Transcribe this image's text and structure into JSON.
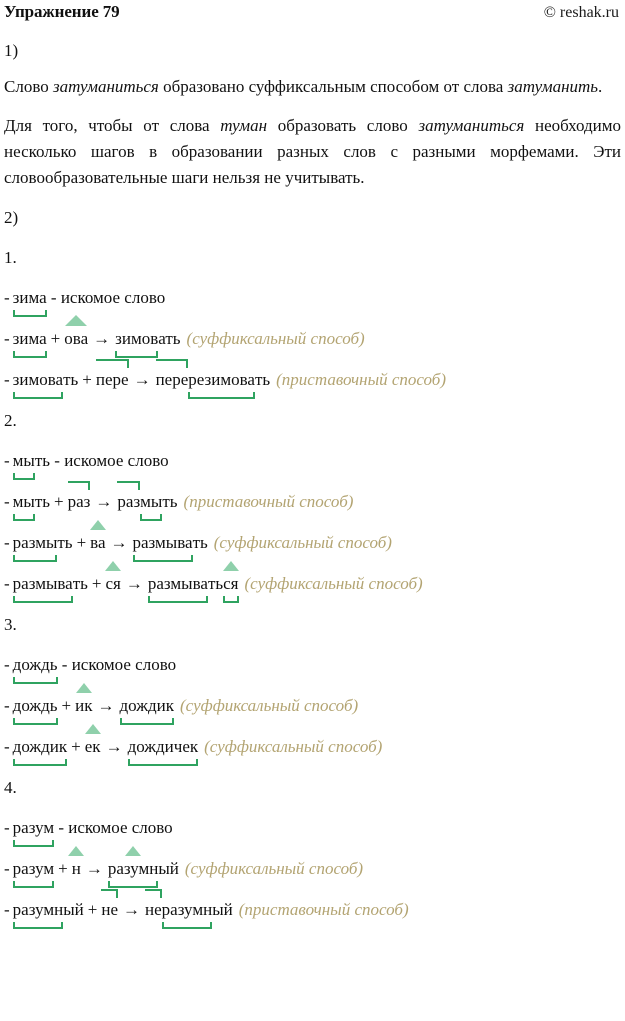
{
  "header": {
    "title": "Упражнение 79",
    "watermark": "© reshak.ru"
  },
  "part1": {
    "marker": "1)",
    "paragraphs": [
      {
        "id": "p1",
        "runs": [
          {
            "text": "Слово ",
            "style": "normal"
          },
          {
            "text": "затуманиться",
            "style": "italic"
          },
          {
            "text": " образовано суффиксальным способом от слова ",
            "style": "normal"
          },
          {
            "text": "затуманить",
            "style": "italic"
          },
          {
            "text": ".",
            "style": "normal"
          }
        ],
        "plain": "Слово затуманиться образовано суффиксальным способом от слова затуманить."
      },
      {
        "id": "p2",
        "runs": [
          {
            "text": "Для того, чтобы от слова ",
            "style": "normal"
          },
          {
            "text": "туман",
            "style": "italic"
          },
          {
            "text": " образовать слово ",
            "style": "normal"
          },
          {
            "text": "затуманиться",
            "style": "italic"
          },
          {
            "text": " необходимо несколько шагов в образовании разных слов с разными морфемами. Эти словообразовательные шаги нельзя не учитывать.",
            "style": "normal"
          }
        ],
        "plain": "Для того, чтобы от слова туман образовать слово затуманиться необходимо несколько шагов в образовании разных слов с разными морфемами. Эти словообразовательные шаги нельзя не учитывать."
      }
    ]
  },
  "part2": {
    "marker": "2)",
    "operators": {
      "dash": "-",
      "plus": "+",
      "arrow": "→"
    },
    "notes": {
      "suffix": "(суффиксальный способ)",
      "prefix": "(приставочный способ)"
    },
    "sought_label": "- искомое слово",
    "sections": [
      {
        "number": "1.",
        "lines": [
          {
            "type": "sought",
            "word": "зима",
            "root": "зима",
            "tail": "",
            "label": "- искомое слово"
          },
          {
            "type": "derive",
            "base_root": "зима",
            "base_tail": "",
            "affix": "ова",
            "affix_kind": "suffix",
            "result_root": "зимов",
            "result_tail": "ать",
            "result_suffix": "ов",
            "note": "(суффиксальный способ)"
          },
          {
            "type": "derive",
            "base_root": "зимова",
            "base_tail": "ть",
            "affix": "пере",
            "affix_kind": "prefix",
            "result_prefix": "пере",
            "result_root": "резимова",
            "result_tail": "ть",
            "note": "(приставочный способ)"
          }
        ]
      },
      {
        "number": "2.",
        "lines": [
          {
            "type": "sought",
            "word": "мыть",
            "root": "мы",
            "tail": "ть",
            "label": "- искомое слово"
          },
          {
            "type": "derive",
            "base_root": "мы",
            "base_tail": "ть",
            "affix": "раз",
            "affix_kind": "prefix",
            "result_prefix": "раз",
            "result_root": "мы",
            "result_tail": "ть",
            "note": "(приставочный способ)"
          },
          {
            "type": "derive",
            "base_root": "размы",
            "base_tail": "ть",
            "affix": "ва",
            "affix_kind": "suffix",
            "result_root": "размыва",
            "result_tail": "ть",
            "result_suffix": "ва",
            "note": "(суффиксальный способ)"
          },
          {
            "type": "derive",
            "base_root": "размыва",
            "base_tail": "ть",
            "affix": "ся",
            "affix_kind": "suffix",
            "result_root": "размыва",
            "result_mid": "ть",
            "result_suffix2": "ся",
            "note": "(суффиксальный способ)"
          }
        ]
      },
      {
        "number": "3.",
        "lines": [
          {
            "type": "sought",
            "word": "дождь",
            "root": "дождь",
            "tail": "",
            "label": "- искомое слово"
          },
          {
            "type": "derive",
            "base_root": "дождь",
            "base_tail": "",
            "affix": "ик",
            "affix_kind": "suffix",
            "result_root": "дождик",
            "result_tail": "",
            "result_suffix": "ик",
            "note": "(суффиксальный способ)"
          },
          {
            "type": "derive",
            "base_root": "дождик",
            "base_tail": "",
            "affix": "ек",
            "affix_kind": "suffix",
            "result_root": "дождичек",
            "result_tail": "",
            "result_suffix": "ек",
            "note": "(суффиксальный способ)"
          }
        ]
      },
      {
        "number": "4.",
        "lines": [
          {
            "type": "sought",
            "word": "разум",
            "root": "разум",
            "tail": "",
            "label": "- искомое слово"
          },
          {
            "type": "derive",
            "base_root": "разум",
            "base_tail": "",
            "affix": "н",
            "affix_kind": "suffix",
            "result_root": "разумн",
            "result_tail": "ый",
            "result_suffix": "н",
            "note": "(суффиксальный способ)"
          },
          {
            "type": "derive",
            "base_root": "разумн",
            "base_tail": "ый",
            "affix": "не",
            "affix_kind": "prefix",
            "result_prefix": "не",
            "result_root": "разумн",
            "result_tail": "ый",
            "note": "(приставочный способ)"
          }
        ]
      }
    ]
  },
  "colors": {
    "root_bracket": "#2fa360",
    "suffix_caret": "#8fd0ab",
    "note_text": "#b3a472",
    "body_text": "#111111"
  }
}
